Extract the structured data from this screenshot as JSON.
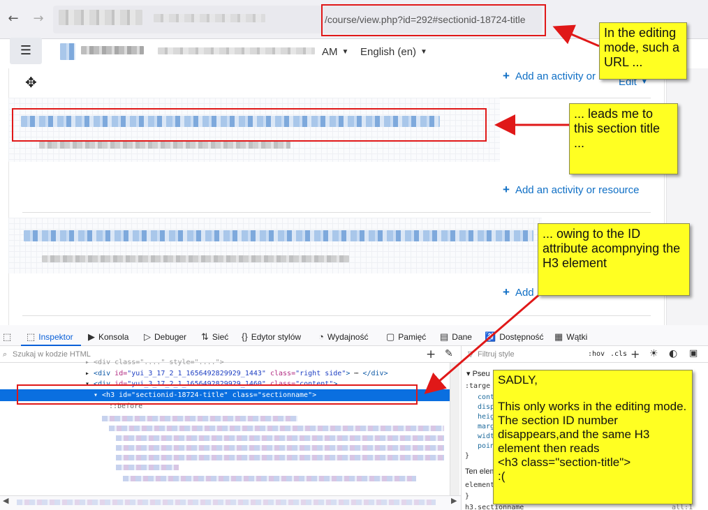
{
  "browser": {
    "back_icon": "←",
    "forward_icon": "→",
    "url_visible": "/course/view.php?id=292#sectionid-18724-title"
  },
  "moodle_nav": {
    "menu_icon": "☰",
    "ampm": "AM",
    "language": "English (en)"
  },
  "course": {
    "move_icon": "✥",
    "add_activity_label": "Add an activity or resource",
    "add_activity_top_partial": "Add an activity or",
    "add_activity_bottom_partial": "Add",
    "edit_label": "Edit"
  },
  "devtools": {
    "tabs": [
      {
        "label": "Inspektor",
        "icon": "⬚"
      },
      {
        "label": "Konsola",
        "icon": "▶"
      },
      {
        "label": "Debuger",
        "icon": "▷"
      },
      {
        "label": "Sieć",
        "icon": "⇅"
      },
      {
        "label": "Edytor stylów",
        "icon": "{}"
      },
      {
        "label": "Wydajność",
        "icon": "◔"
      },
      {
        "label": "Pamięć",
        "icon": "▢"
      },
      {
        "label": "Dane",
        "icon": "▤"
      },
      {
        "label": "Dostępność",
        "icon": "♿"
      },
      {
        "label": "Wątki",
        "icon": "▦"
      }
    ],
    "search_placeholder": "Szukaj w kodzie HTML",
    "filter_placeholder": "Filtruj style",
    "hov": ":hov",
    "cls": ".cls",
    "code_line1_tag": "div",
    "code_line1_id": "yui_3_17_2_1_1656492829929_1443",
    "code_line1_class": "right side",
    "code_line2_id": "yui_3_17_2_1_1656492829929_1460",
    "code_line2_class": "content",
    "selected_id": "sectionid-18724-title",
    "selected_class": "sectionname",
    "pseudo_before": "::before",
    "rules_pseudo": "Pseu",
    "rules_target": ":targe",
    "rules_props": [
      "cont",
      "disp",
      "heig",
      "marg",
      "widt",
      "poin"
    ],
    "rules_ten": "Ten elem",
    "rules_element": "element",
    "rules_h3": "h3.sectionname",
    "rules_all": "all:1"
  },
  "annotations": {
    "note1": "In the editing mode, such a URL ...",
    "note2": "... leads me to this section title ...",
    "note3": "... owing to the ID attribute acompnying the H3 element",
    "note4_title": "SADLY,",
    "note4_body": "This only works in the editing mode. The section ID number disappears,and the same H3 element then reads",
    "note4_code": "<h3 class=\"section-title\">",
    "note4_end": ":(",
    "accent_color": "#ffff22",
    "box_color": "#e01818"
  }
}
